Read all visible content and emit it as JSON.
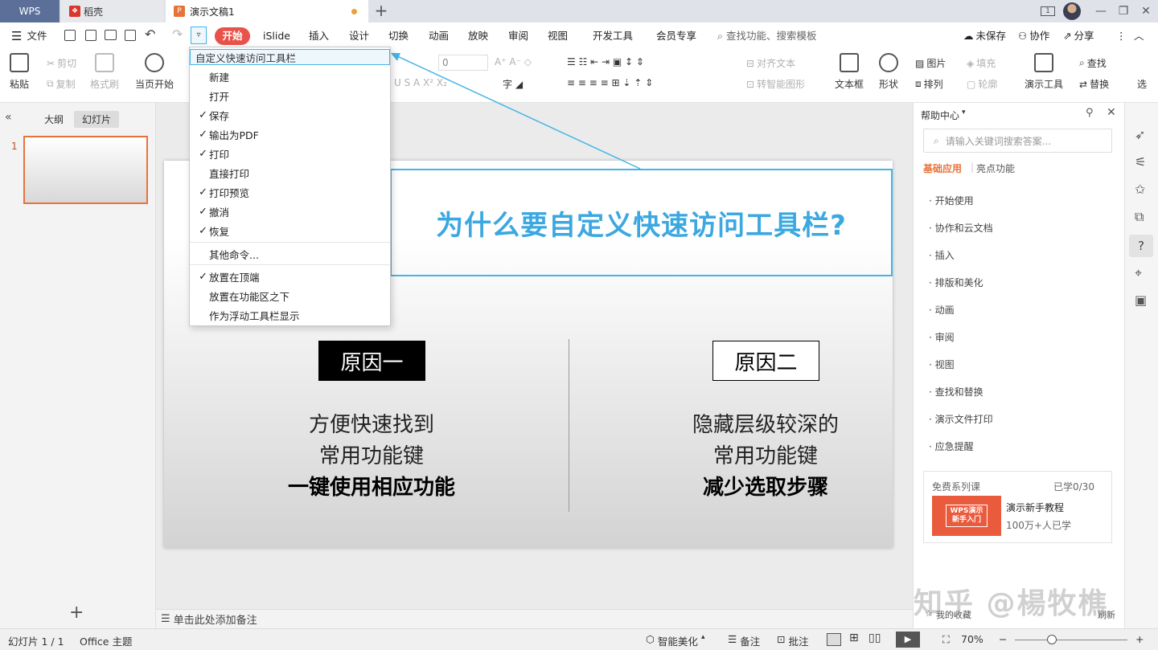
{
  "titlebar": {
    "tabs": [
      {
        "label": "WPS"
      },
      {
        "label": "稻壳"
      },
      {
        "label": "演示文稿1"
      }
    ],
    "new_tab": "+",
    "badge": "1"
  },
  "menubar": {
    "file": "文件",
    "tabs": [
      "开始",
      "iSlide",
      "插入",
      "设计",
      "切换",
      "动画",
      "放映",
      "审阅",
      "视图",
      "开发工具",
      "会员专享"
    ],
    "search_placeholder": "查找功能、搜索模板",
    "unsaved": "未保存",
    "collab": "协作",
    "share": "分享"
  },
  "ribbon": {
    "paste": "粘贴",
    "cut": "剪切",
    "copy": "复制",
    "format_painter": "格式刷",
    "play_from_current": "当页开始",
    "font_size": "0",
    "align_text": "对齐文本",
    "smart_shape": "转智能图形",
    "picture": "图片",
    "fill": "填充",
    "arrange": "排列",
    "outline": "轮廓",
    "textbox": "文本框",
    "shape": "形状",
    "slide_tools": "演示工具",
    "find": "查找",
    "replace": "替换",
    "select": "选"
  },
  "dropdown": {
    "header": "自定义快速访问工具栏",
    "items": [
      {
        "label": "新建",
        "checked": ""
      },
      {
        "label": "打开",
        "checked": ""
      },
      {
        "label": "保存",
        "checked": "✓"
      },
      {
        "label": "输出为PDF",
        "checked": "✓"
      },
      {
        "label": "打印",
        "checked": "✓"
      },
      {
        "label": "直接打印",
        "checked": ""
      },
      {
        "label": "打印预览",
        "checked": "✓"
      },
      {
        "label": "撤消",
        "checked": "✓"
      },
      {
        "label": "恢复",
        "checked": "✓"
      }
    ],
    "more": "其他命令...",
    "positions": [
      {
        "label": "放置在顶端",
        "checked": "✓"
      },
      {
        "label": "放置在功能区之下",
        "checked": ""
      },
      {
        "label": "作为浮动工具栏显示",
        "checked": ""
      }
    ]
  },
  "left_panel": {
    "outline_tab": "大纲",
    "slides_tab": "幻灯片",
    "slide_number": "1",
    "add": "+"
  },
  "slide": {
    "title": "为什么要自定义快速访问工具栏?",
    "reason1": {
      "label": "原因一",
      "lines": [
        "方便快速找到",
        "常用功能键"
      ],
      "bold": "一键使用相应功能"
    },
    "reason2": {
      "label": "原因二",
      "lines": [
        "隐藏层级较深的",
        "常用功能键"
      ],
      "bold": "减少选取步骤"
    }
  },
  "notes": "单击此处添加备注",
  "help": {
    "title": "帮助中心",
    "search_placeholder": "请输入关键词搜索答案...",
    "tabs": [
      "基础应用",
      "亮点功能"
    ],
    "items": [
      "开始使用",
      "协作和云文档",
      "插入",
      "排版和美化",
      "动画",
      "审阅",
      "视图",
      "查找和替换",
      "演示文件打印",
      "应急提醒"
    ],
    "course": {
      "title": "免费系列课",
      "progress": "已学0/30",
      "thumb_line1": "WPS演示",
      "thumb_line2": "新手入门",
      "name": "演示新手教程",
      "learners": "100万+人已学"
    }
  },
  "status": {
    "slide_count": "幻灯片 1 / 1",
    "theme": "Office 主题",
    "beautify": "智能美化",
    "notes": "备注",
    "comment": "批注",
    "zoom": "70%",
    "watermark": "知乎 @楊牧樵",
    "fav": "我的收藏",
    "refresh": "刷新"
  },
  "colors": {
    "accent": "#e8524a",
    "title_blue": "#3ba8e0",
    "highlight": "#45b4e6",
    "help_tab": "#e8733a"
  }
}
